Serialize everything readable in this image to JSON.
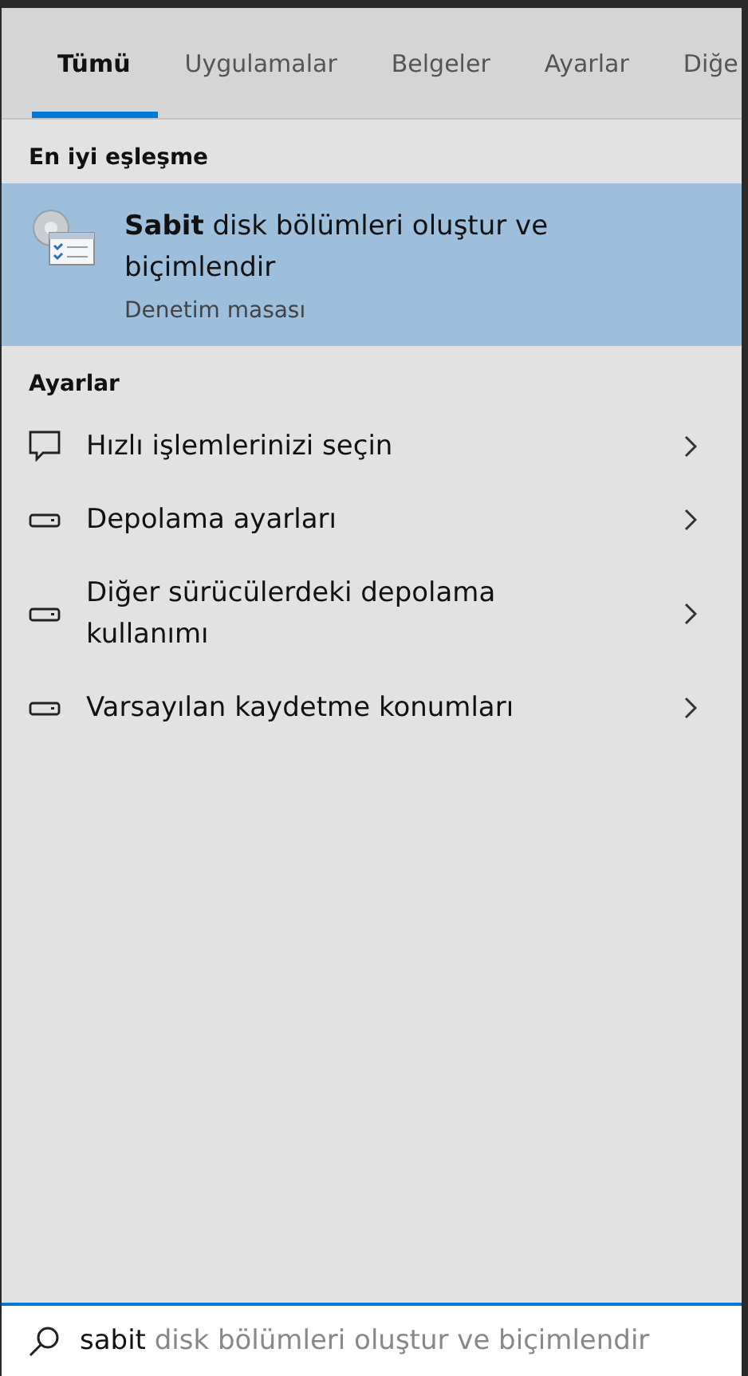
{
  "tabs": [
    {
      "label": "Tümü",
      "selected": true
    },
    {
      "label": "Uygulamalar",
      "selected": false
    },
    {
      "label": "Belgeler",
      "selected": false
    },
    {
      "label": "Ayarlar",
      "selected": false
    },
    {
      "label": "Diğe",
      "selected": false
    }
  ],
  "best_match": {
    "heading": "En iyi eşleşme",
    "title": "**Sabit** disk bölümleri oluştur ve biçimlendir",
    "subtitle": "Denetim masası",
    "selected": true
  },
  "settings": {
    "heading": "Ayarlar",
    "items": [
      {
        "kind": "comment",
        "label": "Hızlı işlemlerinizi seçin"
      },
      {
        "kind": "drive",
        "label": "Depolama ayarları"
      },
      {
        "kind": "drive",
        "label": "Diğer sürücülerdeki depolama kullanımı"
      },
      {
        "kind": "drive",
        "label": "Varsayılan kaydetme konumları"
      }
    ]
  },
  "search": {
    "value": "sabit",
    "suggestion": "disk bölümleri oluştur ve biçimlendir"
  }
}
